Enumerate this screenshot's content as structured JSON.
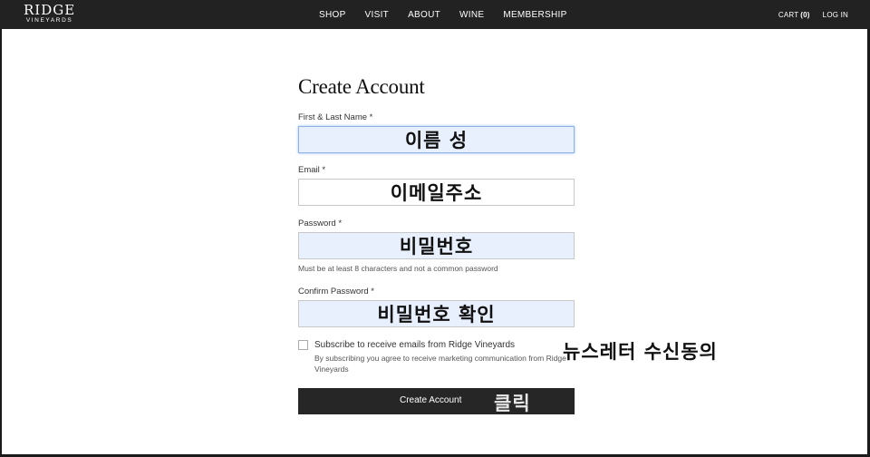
{
  "header": {
    "logo": {
      "main": "RIDGE",
      "sub": "VINEYARDS"
    },
    "nav": [
      {
        "label": "SHOP"
      },
      {
        "label": "VISIT"
      },
      {
        "label": "ABOUT"
      },
      {
        "label": "WINE"
      },
      {
        "label": "MEMBERSHIP"
      }
    ],
    "cart": {
      "label": "CART",
      "count": "(0)"
    },
    "login_label": "LOG IN"
  },
  "form": {
    "title": "Create Account",
    "required_mark": "*",
    "name": {
      "label": "First & Last Name",
      "value": "이름 성"
    },
    "email": {
      "label": "Email",
      "value": "이메일주소"
    },
    "password": {
      "label": "Password",
      "value": "비밀번호",
      "hint": "Must be at least 8 characters and not a common password"
    },
    "confirm": {
      "label": "Confirm Password",
      "value": "비밀번호 확인"
    },
    "subscribe": {
      "label": "Subscribe to receive emails from Ridge Vineyards",
      "description": "By subscribing you agree to receive marketing communication from Ridge Vineyards",
      "checked": false,
      "annotation": "뉴스레터 수신동의"
    },
    "submit": {
      "label": "Create Account",
      "annotation": "클릭"
    }
  }
}
